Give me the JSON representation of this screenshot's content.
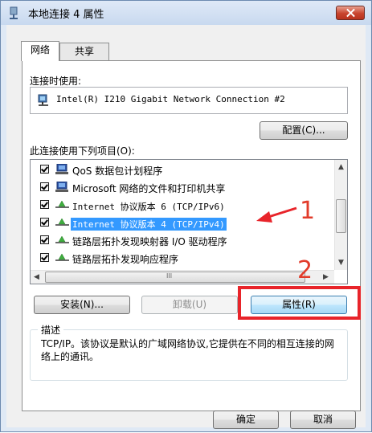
{
  "window": {
    "title": "本地连接 4 属性",
    "accent": "#3399ff"
  },
  "tabs": [
    {
      "label": "网络"
    },
    {
      "label": "共享"
    }
  ],
  "connect_using": {
    "label": "连接时使用:",
    "adapter": "Intel(R) I210 Gigabit Network Connection #2",
    "configure_button": "配置(C)..."
  },
  "items": {
    "label": "此连接使用下列项目(O):",
    "list": [
      {
        "label": "QoS 数据包计划程序",
        "icon": "network-client-icon",
        "checked": true
      },
      {
        "label": "Microsoft 网络的文件和打印机共享",
        "icon": "network-client-icon",
        "checked": true
      },
      {
        "label": "Internet 协议版本 6 (TCP/IPv6)",
        "icon": "protocol-icon",
        "checked": true
      },
      {
        "label": "Internet 协议版本 4 (TCP/IPv4)",
        "icon": "protocol-icon",
        "checked": true,
        "selected": true
      },
      {
        "label": "链路层拓扑发现映射器 I/O 驱动程序",
        "icon": "protocol-icon",
        "checked": true
      },
      {
        "label": "链路层拓扑发现响应程序",
        "icon": "protocol-icon",
        "checked": true
      }
    ],
    "hscroll_thumb_glyph": "III"
  },
  "buttons": {
    "install": "安装(N)...",
    "uninstall": "卸载(U)",
    "properties": "属性(R)",
    "ok": "确定",
    "cancel": "取消"
  },
  "description": {
    "title": "描述",
    "text": "TCP/IP。该协议是默认的广域网络协议,它提供在不同的相互连接的网络上的通讯。"
  },
  "annotations": {
    "step1": "1",
    "step2": "2",
    "color": "#e8242a"
  }
}
